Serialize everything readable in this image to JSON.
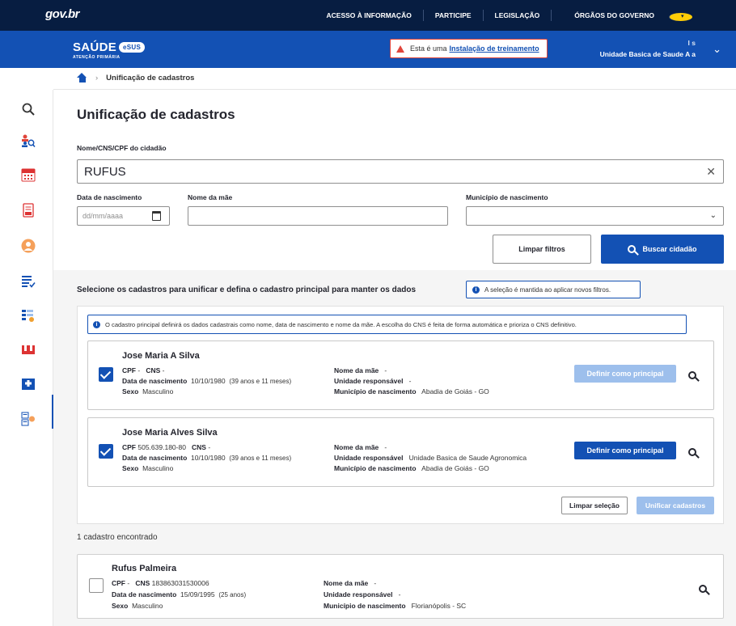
{
  "govbar": {
    "logo": "gov.br",
    "links": [
      "ACESSO À INFORMAÇÃO",
      "PARTICIPE",
      "LEGISLAÇÃO",
      "ÓRGÃOS DO GOVERNO"
    ]
  },
  "header": {
    "brand": "SAÚDE",
    "brand_badge": "SUS",
    "brand_sub": "ATENÇÃO PRIMÁRIA",
    "warning_text": "Esta é uma",
    "warning_link": "Instalação de treinamento",
    "user_line1": "I            s",
    "user_line2": "Unidade Basica de Saude A               a"
  },
  "breadcrumb": {
    "current": "Unificação de cadastros"
  },
  "page": {
    "title": "Unificação de cadastros"
  },
  "search": {
    "name_label": "Nome/CNS/CPF do cidadão",
    "name_value": "RUFUS",
    "birth_label": "Data de nascimento",
    "birth_placeholder": "dd/mm/aaaa",
    "mother_label": "Nome da mãe",
    "city_label": "Município de nascimento",
    "clear_label": "Limpar filtros",
    "search_label": "Buscar cidadão"
  },
  "selection": {
    "title": "Selecione os cadastros para unificar e defina o cadastro principal para manter os dados",
    "chip": "A seleção é mantida ao aplicar novos filtros.",
    "note": "O cadastro principal definirá os dados cadastrais como nome, data de nascimento e nome da mãe. A escolha do CNS é feita de forma automática e prioriza o CNS definitivo.",
    "clear_label": "Limpar seleção",
    "unify_label": "Unificar cadastros"
  },
  "labels": {
    "cpf": "CPF",
    "cns": "CNS",
    "birth": "Data de nascimento",
    "sex": "Sexo",
    "mother": "Nome da mãe",
    "unit": "Unidade responsável",
    "city": "Município de nascimento",
    "define_principal": "Definir como principal"
  },
  "selected_cards": [
    {
      "name": "Jose Maria A Silva",
      "cpf": "-",
      "cns": "-",
      "birth": "10/10/1980",
      "age": "(39 anos e 11 meses)",
      "sex": "Masculino",
      "mother": "-",
      "unit": "-",
      "city": "Abadia de Goiás - GO"
    },
    {
      "name": "Jose Maria Alves Silva",
      "cpf": "505.639.180-80",
      "cns": "-",
      "birth": "10/10/1980",
      "age": "(39 anos e 11 meses)",
      "sex": "Masculino",
      "mother": "-",
      "unit": "Unidade Basica de Saude Agronomica",
      "city": "Abadia de Goiás - GO"
    }
  ],
  "results": {
    "count_text": "1 cadastro encontrado",
    "items": [
      {
        "name": "Rufus Palmeira",
        "cpf": "-",
        "cns": "183863031530006",
        "birth": "15/09/1995",
        "age": "(25 anos)",
        "sex": "Masculino",
        "mother": "-",
        "unit": "-",
        "city": "Florianópolis - SC"
      }
    ]
  },
  "colors": {
    "gov_bar": "#071d41",
    "header": "#1351b4",
    "primary": "#1351b4",
    "disabled": "#9dbfec",
    "warning": "#e0453b"
  }
}
